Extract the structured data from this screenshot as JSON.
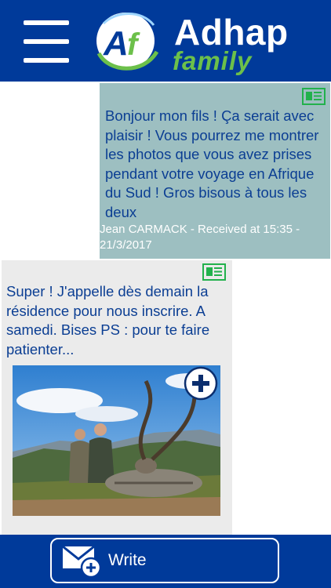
{
  "header": {
    "brand_mark": "Af",
    "brand_title": "Adhap",
    "brand_subtitle": "family",
    "colors": {
      "bar": "#003a9a",
      "accent_green": "#6cc04a"
    }
  },
  "messages": [
    {
      "text": "Bonjour mon fils ! Ça serait avec plaisir ! Vous pourrez me montrer les photos que vous avez prises pendant votre voyage en Afrique du Sud ! Gros bisous à tous les deux",
      "meta": "Jean CARMACK - Received at 15:35 - 21/3/2017",
      "icon": "newspaper-icon"
    },
    {
      "text": "Super ! J'appelle dès demain la résidence pour nous inscrire. A samedi. Bises PS : pour te faire patienter...",
      "icon": "newspaper-icon",
      "attachment_icon": "zoom-plus-icon"
    }
  ],
  "footer": {
    "write_label": "Write",
    "write_icon": "envelope-plus-icon"
  }
}
